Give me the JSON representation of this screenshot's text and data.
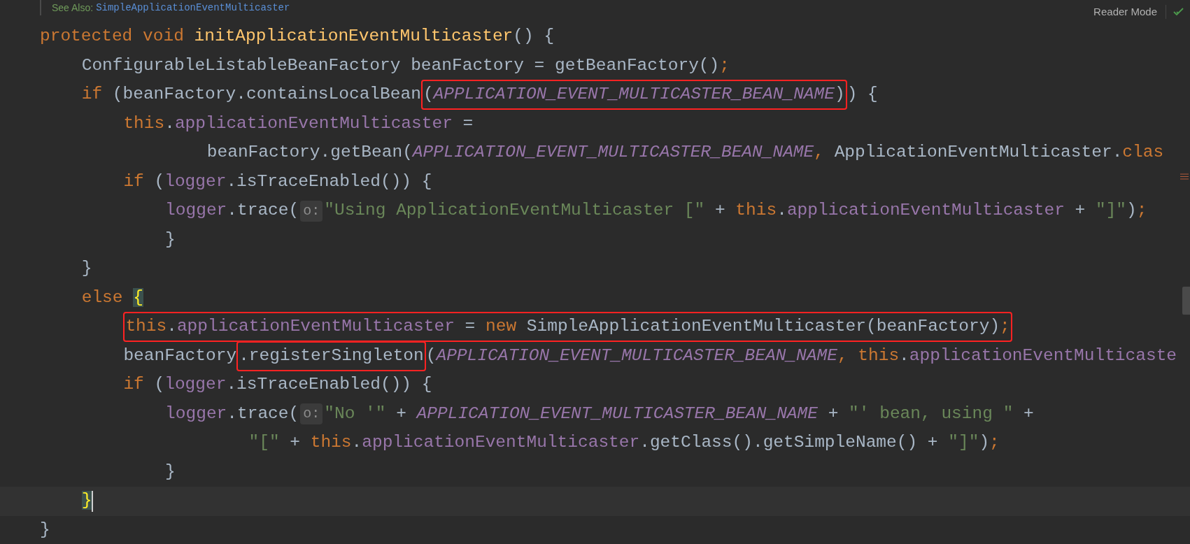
{
  "doc_hint": {
    "label": "See Also:",
    "link": "SimpleApplicationEventMulticaster"
  },
  "reader_mode": {
    "label": "Reader Mode"
  },
  "code_lines": [
    {
      "tokens": [
        {
          "kind": "kw",
          "text": "protected void "
        },
        {
          "kind": "decl",
          "text": "initApplicationEventMulticaster"
        },
        {
          "kind": "plain",
          "text": "() {"
        }
      ],
      "children": [
        {
          "tokens": [
            {
              "kind": "plain",
              "text": "ConfigurableListableBeanFactory beanFactory = getBeanFactory()"
            },
            {
              "kind": "kw",
              "text": ";"
            }
          ]
        },
        {
          "tokens": [
            {
              "kind": "kw",
              "text": "if "
            },
            {
              "kind": "plain",
              "text": "(beanFactory.containsLocalBean"
            },
            {
              "kind": "box",
              "children": [
                {
                  "kind": "plain",
                  "text": "("
                },
                {
                  "kind": "const",
                  "text": "APPLICATION_EVENT_MULTICASTER_BEAN_NAME"
                },
                {
                  "kind": "plain",
                  "text": ")"
                }
              ]
            },
            {
              "kind": "plain",
              "text": ") {"
            }
          ],
          "children": [
            {
              "tokens": [
                {
                  "kind": "kw",
                  "text": "this"
                },
                {
                  "kind": "plain",
                  "text": "."
                },
                {
                  "kind": "field",
                  "text": "applicationEventMulticaster"
                },
                {
                  "kind": "plain",
                  "text": " ="
                }
              ],
              "children": [
                {
                  "continuation": true,
                  "tokens": [
                    {
                      "kind": "plain",
                      "text": "beanFactory.getBean("
                    },
                    {
                      "kind": "const",
                      "text": "APPLICATION_EVENT_MULTICASTER_BEAN_NAME"
                    },
                    {
                      "kind": "kw",
                      "text": ", "
                    },
                    {
                      "kind": "plain",
                      "text": "ApplicationEventMulticaster."
                    },
                    {
                      "kind": "kw",
                      "text": "clas"
                    }
                  ]
                }
              ]
            },
            {
              "tokens": [
                {
                  "kind": "kw",
                  "text": "if "
                },
                {
                  "kind": "plain",
                  "text": "("
                },
                {
                  "kind": "field",
                  "text": "logger"
                },
                {
                  "kind": "plain",
                  "text": ".isTraceEnabled()) {"
                }
              ],
              "children": [
                {
                  "tokens": [
                    {
                      "kind": "field",
                      "text": "logger"
                    },
                    {
                      "kind": "plain",
                      "text": ".trace("
                    },
                    {
                      "kind": "hint",
                      "text": "o:"
                    },
                    {
                      "kind": "str",
                      "text": "\"Using ApplicationEventMulticaster [\""
                    },
                    {
                      "kind": "plain",
                      "text": " + "
                    },
                    {
                      "kind": "kw",
                      "text": "this"
                    },
                    {
                      "kind": "plain",
                      "text": "."
                    },
                    {
                      "kind": "field",
                      "text": "applicationEventMulticaster"
                    },
                    {
                      "kind": "plain",
                      "text": " + "
                    },
                    {
                      "kind": "str",
                      "text": "\"]\""
                    },
                    {
                      "kind": "plain",
                      "text": ")"
                    },
                    {
                      "kind": "kw",
                      "text": ";"
                    }
                  ]
                },
                {
                  "tokens": [
                    {
                      "kind": "plain",
                      "text": "}"
                    }
                  ]
                }
              ]
            }
          ]
        },
        {
          "tokens": [
            {
              "kind": "plain",
              "text": "}"
            }
          ]
        },
        {
          "tokens": [
            {
              "kind": "kw",
              "text": "else "
            },
            {
              "kind": "brace",
              "text": "{"
            }
          ],
          "children": [
            {
              "tokens": [
                {
                  "kind": "box",
                  "children": [
                    {
                      "kind": "kw",
                      "text": "this"
                    },
                    {
                      "kind": "plain",
                      "text": "."
                    },
                    {
                      "kind": "field",
                      "text": "applicationEventMulticaster"
                    },
                    {
                      "kind": "plain",
                      "text": " = "
                    },
                    {
                      "kind": "kw",
                      "text": "new "
                    },
                    {
                      "kind": "plain",
                      "text": "SimpleApplicationEventMulticaster(beanFactory)"
                    },
                    {
                      "kind": "kw",
                      "text": ";"
                    }
                  ]
                }
              ]
            },
            {
              "tokens": [
                {
                  "kind": "plain",
                  "text": "beanFactory"
                },
                {
                  "kind": "box",
                  "children": [
                    {
                      "kind": "plain",
                      "text": ".registerSingleton"
                    }
                  ]
                },
                {
                  "kind": "plain",
                  "text": "("
                },
                {
                  "kind": "const",
                  "text": "APPLICATION_EVENT_MULTICASTER_BEAN_NAME"
                },
                {
                  "kind": "kw",
                  "text": ", this"
                },
                {
                  "kind": "plain",
                  "text": "."
                },
                {
                  "kind": "field",
                  "text": "applicationEventMulticaste"
                }
              ]
            },
            {
              "tokens": [
                {
                  "kind": "kw",
                  "text": "if "
                },
                {
                  "kind": "plain",
                  "text": "("
                },
                {
                  "kind": "field",
                  "text": "logger"
                },
                {
                  "kind": "plain",
                  "text": ".isTraceEnabled()) {"
                }
              ],
              "children": [
                {
                  "tokens": [
                    {
                      "kind": "field",
                      "text": "logger"
                    },
                    {
                      "kind": "plain",
                      "text": ".trace("
                    },
                    {
                      "kind": "hint",
                      "text": "o:"
                    },
                    {
                      "kind": "str",
                      "text": "\"No '\""
                    },
                    {
                      "kind": "plain",
                      "text": " + "
                    },
                    {
                      "kind": "const",
                      "text": "APPLICATION_EVENT_MULTICASTER_BEAN_NAME"
                    },
                    {
                      "kind": "plain",
                      "text": " + "
                    },
                    {
                      "kind": "str",
                      "text": "\"' bean, using \""
                    },
                    {
                      "kind": "plain",
                      "text": " +"
                    }
                  ],
                  "children": [
                    {
                      "continuation": true,
                      "tokens": [
                        {
                          "kind": "str",
                          "text": "\"[\""
                        },
                        {
                          "kind": "plain",
                          "text": " + "
                        },
                        {
                          "kind": "kw",
                          "text": "this"
                        },
                        {
                          "kind": "plain",
                          "text": "."
                        },
                        {
                          "kind": "field",
                          "text": "applicationEventMulticaster"
                        },
                        {
                          "kind": "plain",
                          "text": ".getClass().getSimpleName() + "
                        },
                        {
                          "kind": "str",
                          "text": "\"]\""
                        },
                        {
                          "kind": "plain",
                          "text": ")"
                        },
                        {
                          "kind": "kw",
                          "text": ";"
                        }
                      ]
                    }
                  ]
                },
                {
                  "tokens": [
                    {
                      "kind": "plain",
                      "text": "}"
                    }
                  ]
                }
              ]
            }
          ]
        },
        {
          "current": true,
          "tokens": [
            {
              "kind": "brace",
              "text": "}"
            }
          ]
        }
      ]
    },
    {
      "tokens": [
        {
          "kind": "plain",
          "text": "}"
        }
      ]
    }
  ]
}
